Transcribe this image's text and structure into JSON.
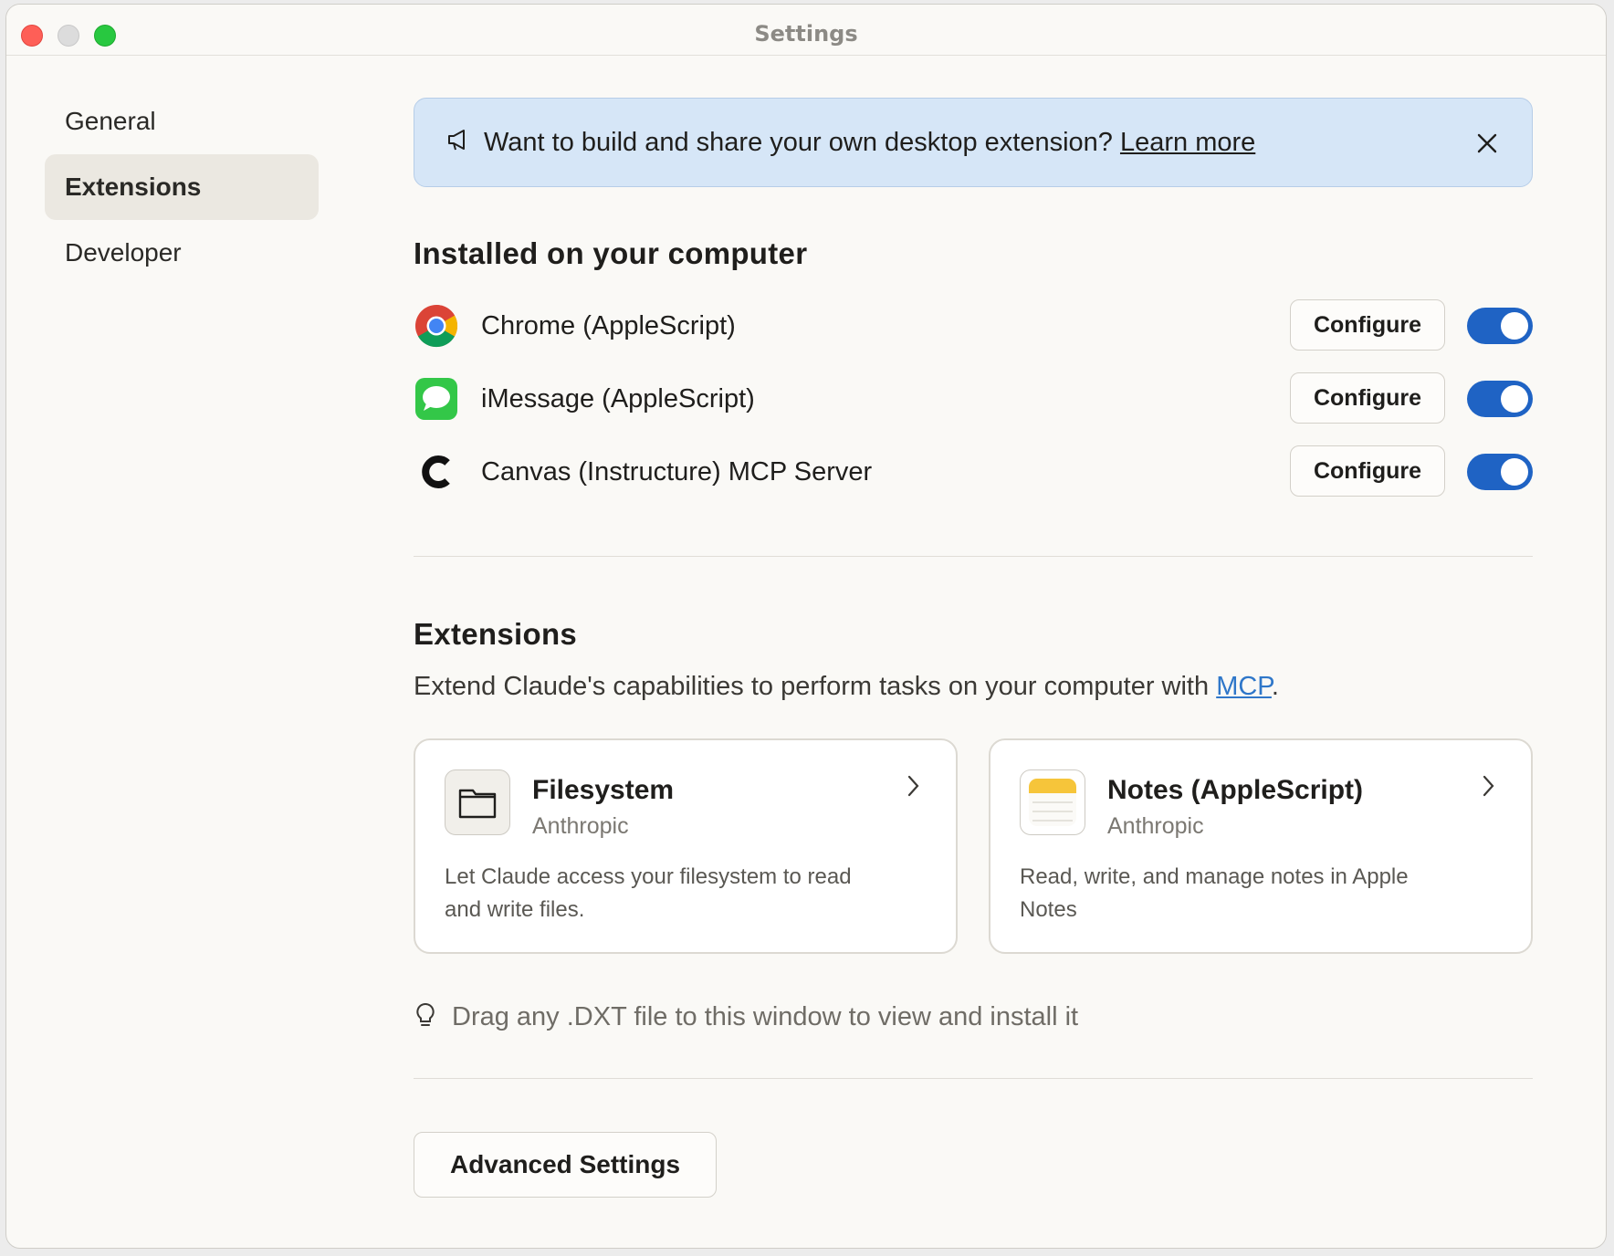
{
  "window": {
    "title": "Settings"
  },
  "sidebar": {
    "items": [
      {
        "label": "General",
        "active": false
      },
      {
        "label": "Extensions",
        "active": true
      },
      {
        "label": "Developer",
        "active": false
      }
    ]
  },
  "banner": {
    "text": "Want to build and share your own desktop extension?",
    "link": "Learn more",
    "icon": "megaphone-icon"
  },
  "installed": {
    "title": "Installed on your computer",
    "configure_label": "Configure",
    "items": [
      {
        "name": "Chrome (AppleScript)",
        "icon": "chrome-icon",
        "enabled": true
      },
      {
        "name": "iMessage (AppleScript)",
        "icon": "imessage-icon",
        "enabled": true
      },
      {
        "name": "Canvas (Instructure) MCP Server",
        "icon": "canvas-icon",
        "enabled": true
      }
    ]
  },
  "extensions": {
    "title": "Extensions",
    "subtitle_prefix": "Extend Claude's capabilities to perform tasks on your computer with ",
    "subtitle_link": "MCP",
    "subtitle_suffix": ".",
    "cards": [
      {
        "title": "Filesystem",
        "author": "Anthropic",
        "description": "Let Claude access your filesystem to read and write files.",
        "icon": "folder-icon"
      },
      {
        "title": "Notes (AppleScript)",
        "author": "Anthropic",
        "description": "Read, write, and manage notes in Apple Notes",
        "icon": "notes-icon"
      }
    ]
  },
  "hint": {
    "text": "Drag any .DXT file to this window to view and install it",
    "icon": "lightbulb-icon"
  },
  "advanced": {
    "label": "Advanced Settings"
  },
  "colors": {
    "accent": "#1f63c4",
    "banner_bg": "#d6e6f7",
    "link": "#2f77c9"
  }
}
